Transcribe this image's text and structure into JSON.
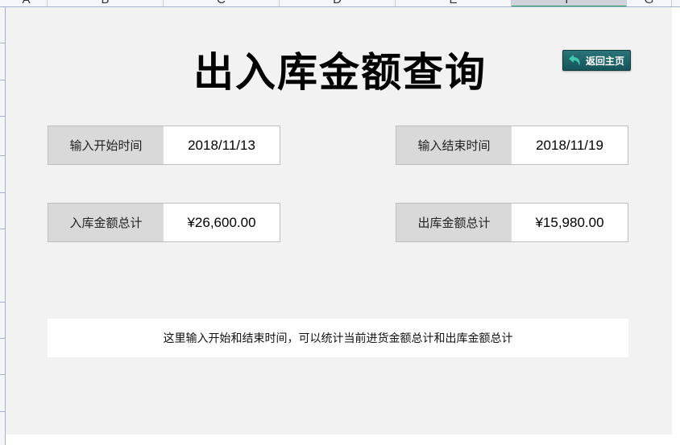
{
  "columns": [
    "A",
    "B",
    "C",
    "D",
    "E",
    "F",
    "G"
  ],
  "title": "出入库金额查询",
  "home_button": {
    "label": "返回主页",
    "icon": "return-arrow-icon"
  },
  "start": {
    "label": "输入开始时间",
    "value": "2018/11/13"
  },
  "end": {
    "label": "输入结束时间",
    "value": "2018/11/19"
  },
  "in_total": {
    "label": "入库金额总计",
    "value": "¥26,600.00"
  },
  "out_total": {
    "label": "出库金额总计",
    "value": "¥15,980.00"
  },
  "note": "这里输入开始和结束时间，可以统计当前进货金额总计和出库金额总计",
  "colors": {
    "accent": "#21a366",
    "button": "#1d6368",
    "label_bg": "#d9d9d9"
  }
}
